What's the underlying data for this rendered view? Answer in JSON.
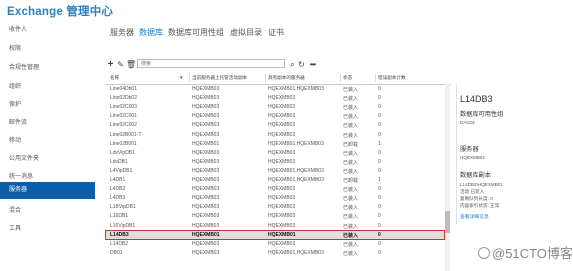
{
  "app": {
    "title": "Exchange 管理中心"
  },
  "sidebar": {
    "items": [
      {
        "label": "收件人"
      },
      {
        "label": "权限"
      },
      {
        "label": "合规性管理"
      },
      {
        "label": "组织"
      },
      {
        "label": "保护"
      },
      {
        "label": "邮件流"
      },
      {
        "label": "移动"
      },
      {
        "label": "公用文件夹"
      },
      {
        "label": "统一消息"
      },
      {
        "label": "服务器",
        "active": true
      },
      {
        "label": "混合"
      },
      {
        "label": "工具"
      }
    ]
  },
  "tabs": [
    {
      "label": "服务器"
    },
    {
      "label": "数据库",
      "active": true
    },
    {
      "label": "数据库可用性组"
    },
    {
      "label": "虚拟目录"
    },
    {
      "label": "证书"
    }
  ],
  "toolbar": {
    "icons": [
      "plus-icon",
      "edit-icon",
      "delete-icon",
      "search-icon",
      "refresh-icon",
      "more-icon"
    ],
    "search_placeholder": "搜索"
  },
  "grid": {
    "columns": [
      "名称",
      "当前服务器上托管活动副本",
      "具有副本的服务器",
      "状态",
      "错误副本计数"
    ],
    "rows": [
      [
        "Line04Db01",
        "HQEXMB03",
        "HQEXMB01,HQEXMB03",
        "已装入",
        "0"
      ],
      [
        "Line02Db02",
        "HQEXMB03",
        "HQEXMB03",
        "已装入",
        "0"
      ],
      [
        "Line02C003",
        "HQEXMB03",
        "HQEXMB03",
        "已装入",
        "0"
      ],
      [
        "Line02C001",
        "HQEXMB03",
        "HQEXMB03",
        "已装入",
        "0"
      ],
      [
        "Line02C002",
        "HQEXMB03",
        "HQEXMB03",
        "已装入",
        "0"
      ],
      [
        "Line02B001-T",
        "HQEXMB03",
        "HQEXMB03",
        "已装入",
        "0"
      ],
      [
        "Line02B001",
        "HQEXMB01",
        "HQEXMB01,HQEXMB03",
        "已卸载",
        "1"
      ],
      [
        "LdvVipDB1",
        "HQEXMB03",
        "HQEXMB03",
        "已装入",
        "0"
      ],
      [
        "LdvDB1",
        "HQEXMB03",
        "HQEXMB03",
        "已装入",
        "0"
      ],
      [
        "L4VipDB1",
        "HQEXMB03",
        "HQEXMB01,HQEXMB03",
        "已装入",
        "0"
      ],
      [
        "L4DB1",
        "HQEXMB03",
        "HQEXMB01,HQEXMB03",
        "已卸载",
        "1"
      ],
      [
        "L4DB2",
        "HQEXMB03",
        "HQEXMB03",
        "已装入",
        "0"
      ],
      [
        "L4DB3",
        "HQEXMB03",
        "HQEXMB03",
        "已装入",
        "0"
      ],
      [
        "L1BVipDB1",
        "HQEXMB03",
        "HQEXMB03",
        "已装入",
        "0"
      ],
      [
        "L16DB1",
        "HQEXMB03",
        "HQEXMB03",
        "已装入",
        "0"
      ],
      [
        "L16VipDB1",
        "HQEXMB03",
        "HQEXMB03",
        "已装入",
        "0"
      ],
      [
        "L14DB3",
        "HQEXMB01",
        "HQEXMB01",
        "已装入",
        "0"
      ],
      [
        "L14DB2",
        "HQEXMB03",
        "HQEXMB03",
        "已装入",
        "0"
      ],
      [
        "DB01",
        "HQEXMB03",
        "HQEXMB01,HQEXMB03",
        "已装入",
        "0"
      ]
    ],
    "selected_index": 16
  },
  "detail": {
    "title": "L14DB3",
    "dag_label": "数据库可用性组",
    "dag_value": "DAG01",
    "servers_label": "服务器",
    "servers_value": "HQEXMB01",
    "copies_label": "数据库副本",
    "copy_lines": [
      "L14DB3\\HQEXMB01",
      "活动 已装入",
      "复制队列长度: 0",
      "内容索引状态: 正常"
    ],
    "link": "查看详细信息"
  },
  "watermark": "@51CTO博客"
}
